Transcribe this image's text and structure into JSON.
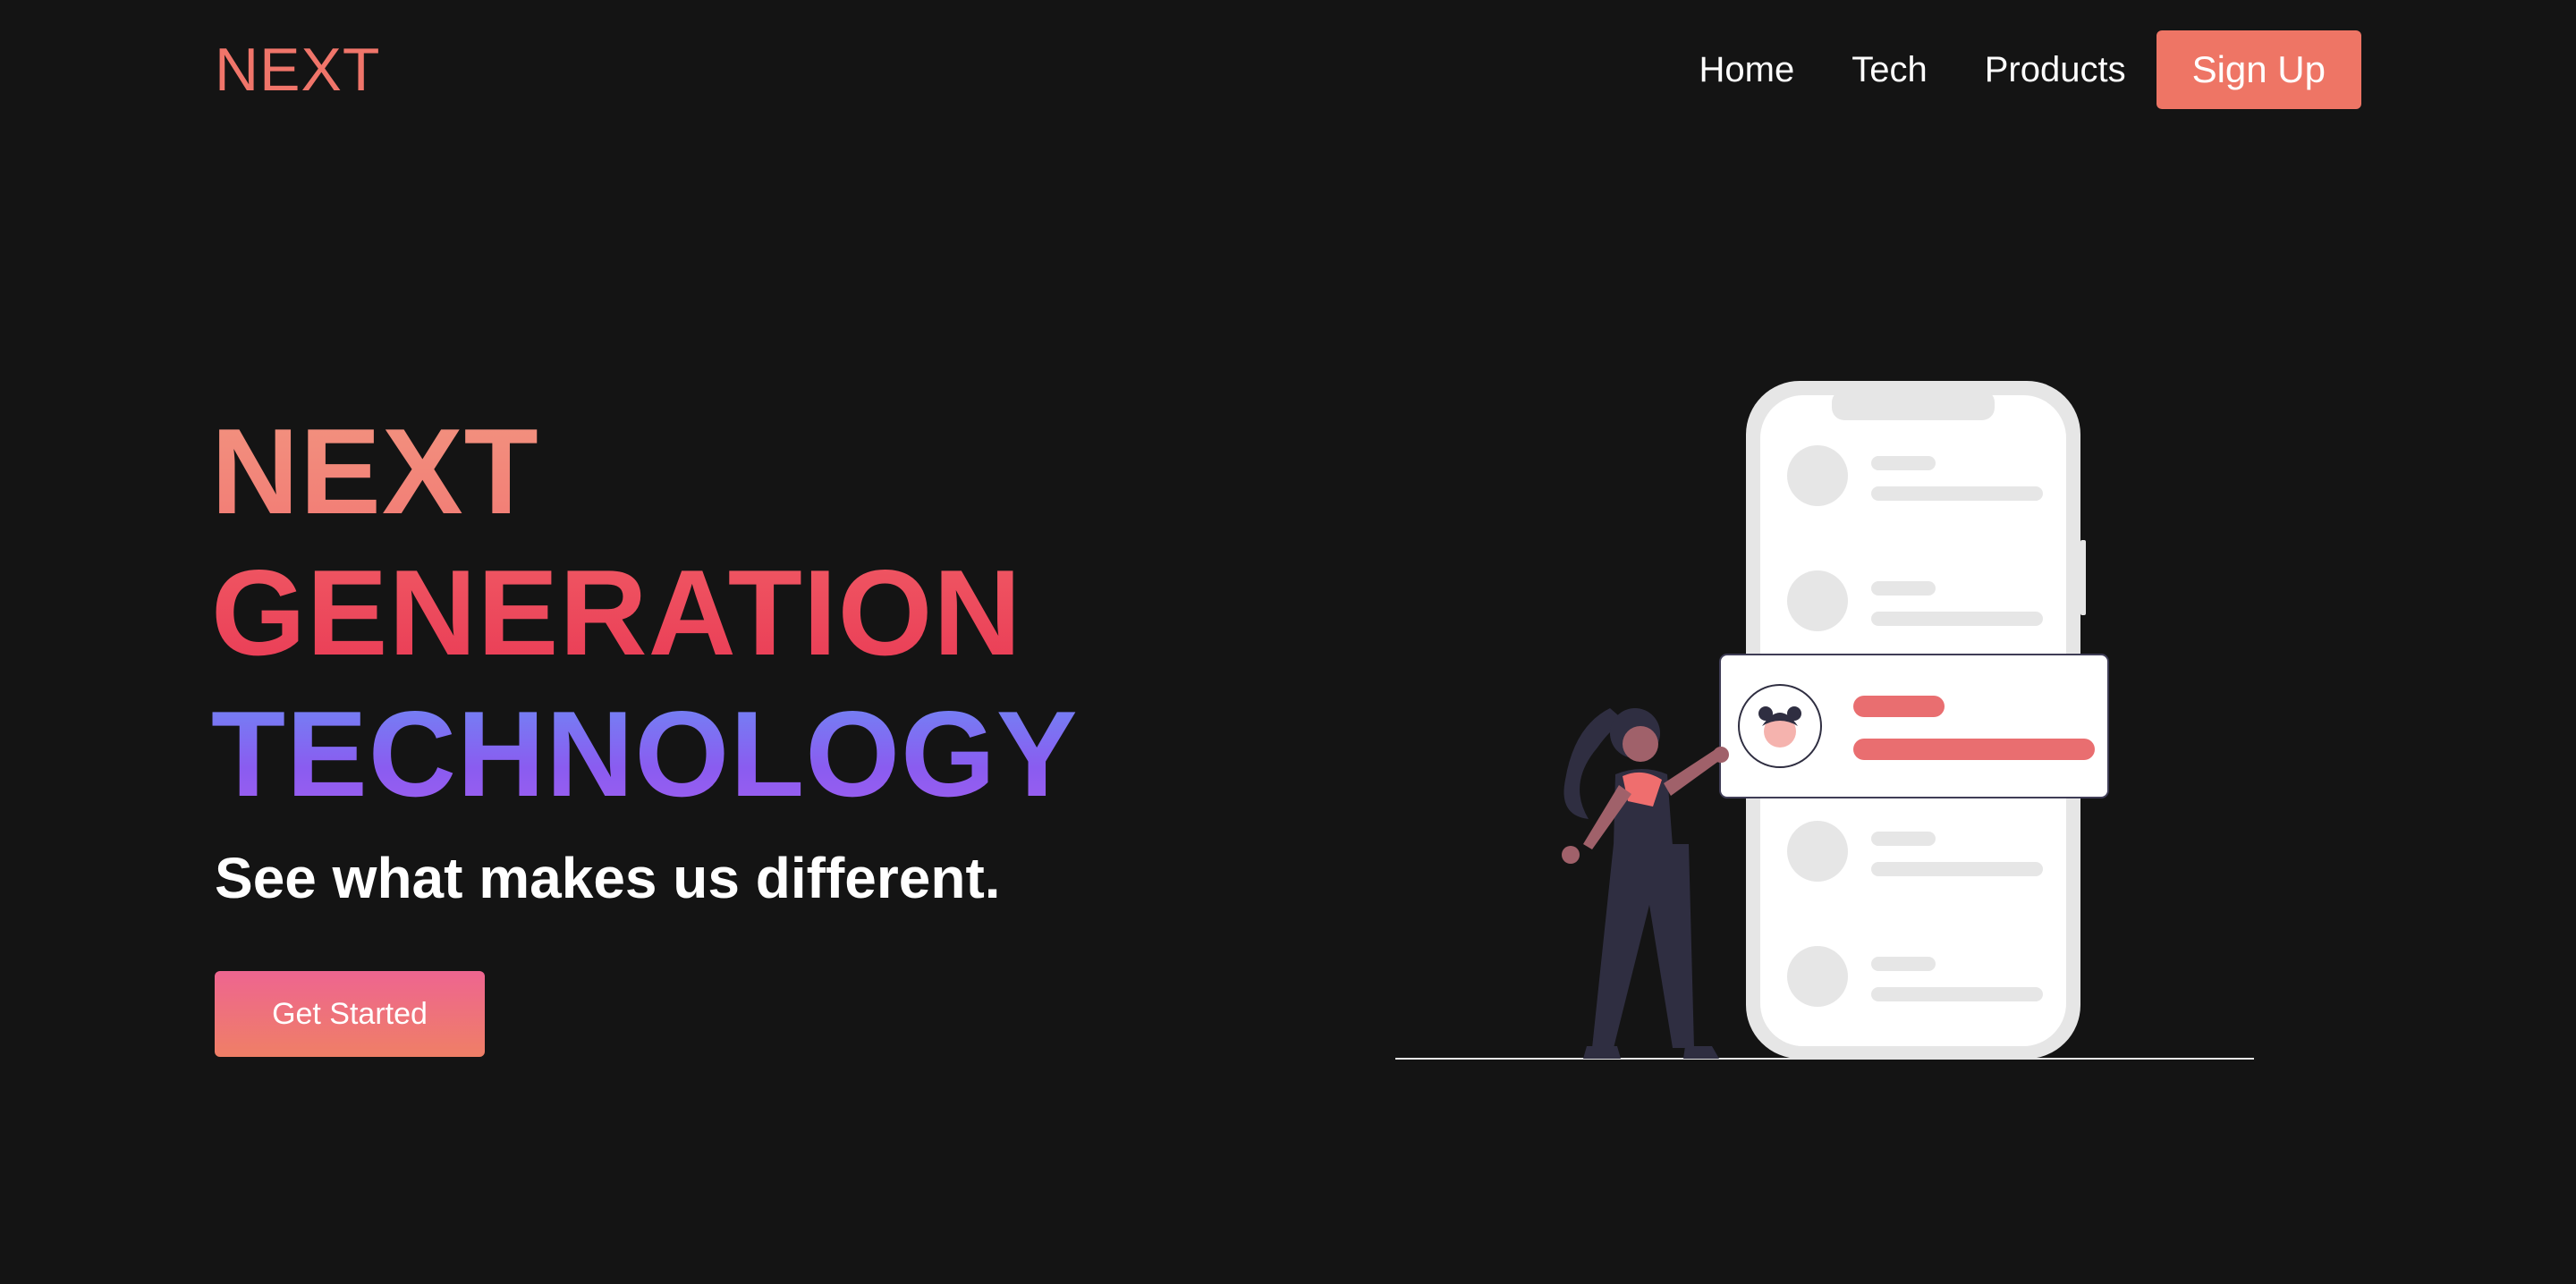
{
  "nav": {
    "logo": "NEXT",
    "links": [
      "Home",
      "Tech",
      "Products"
    ],
    "signup_label": "Sign Up"
  },
  "hero": {
    "title_lines": [
      "NEXT",
      "GENERATION",
      "TECHNOLOGY"
    ],
    "subtitle": "See what makes us different.",
    "cta_label": "Get Started"
  },
  "colors": {
    "background": "#141414",
    "accent": "#ee7565",
    "title_line1": "#f39480",
    "title_line2": "#e93a55",
    "title_line3": "#8a5cf0"
  },
  "illustration": {
    "icon": "person-with-phone-illustration"
  }
}
